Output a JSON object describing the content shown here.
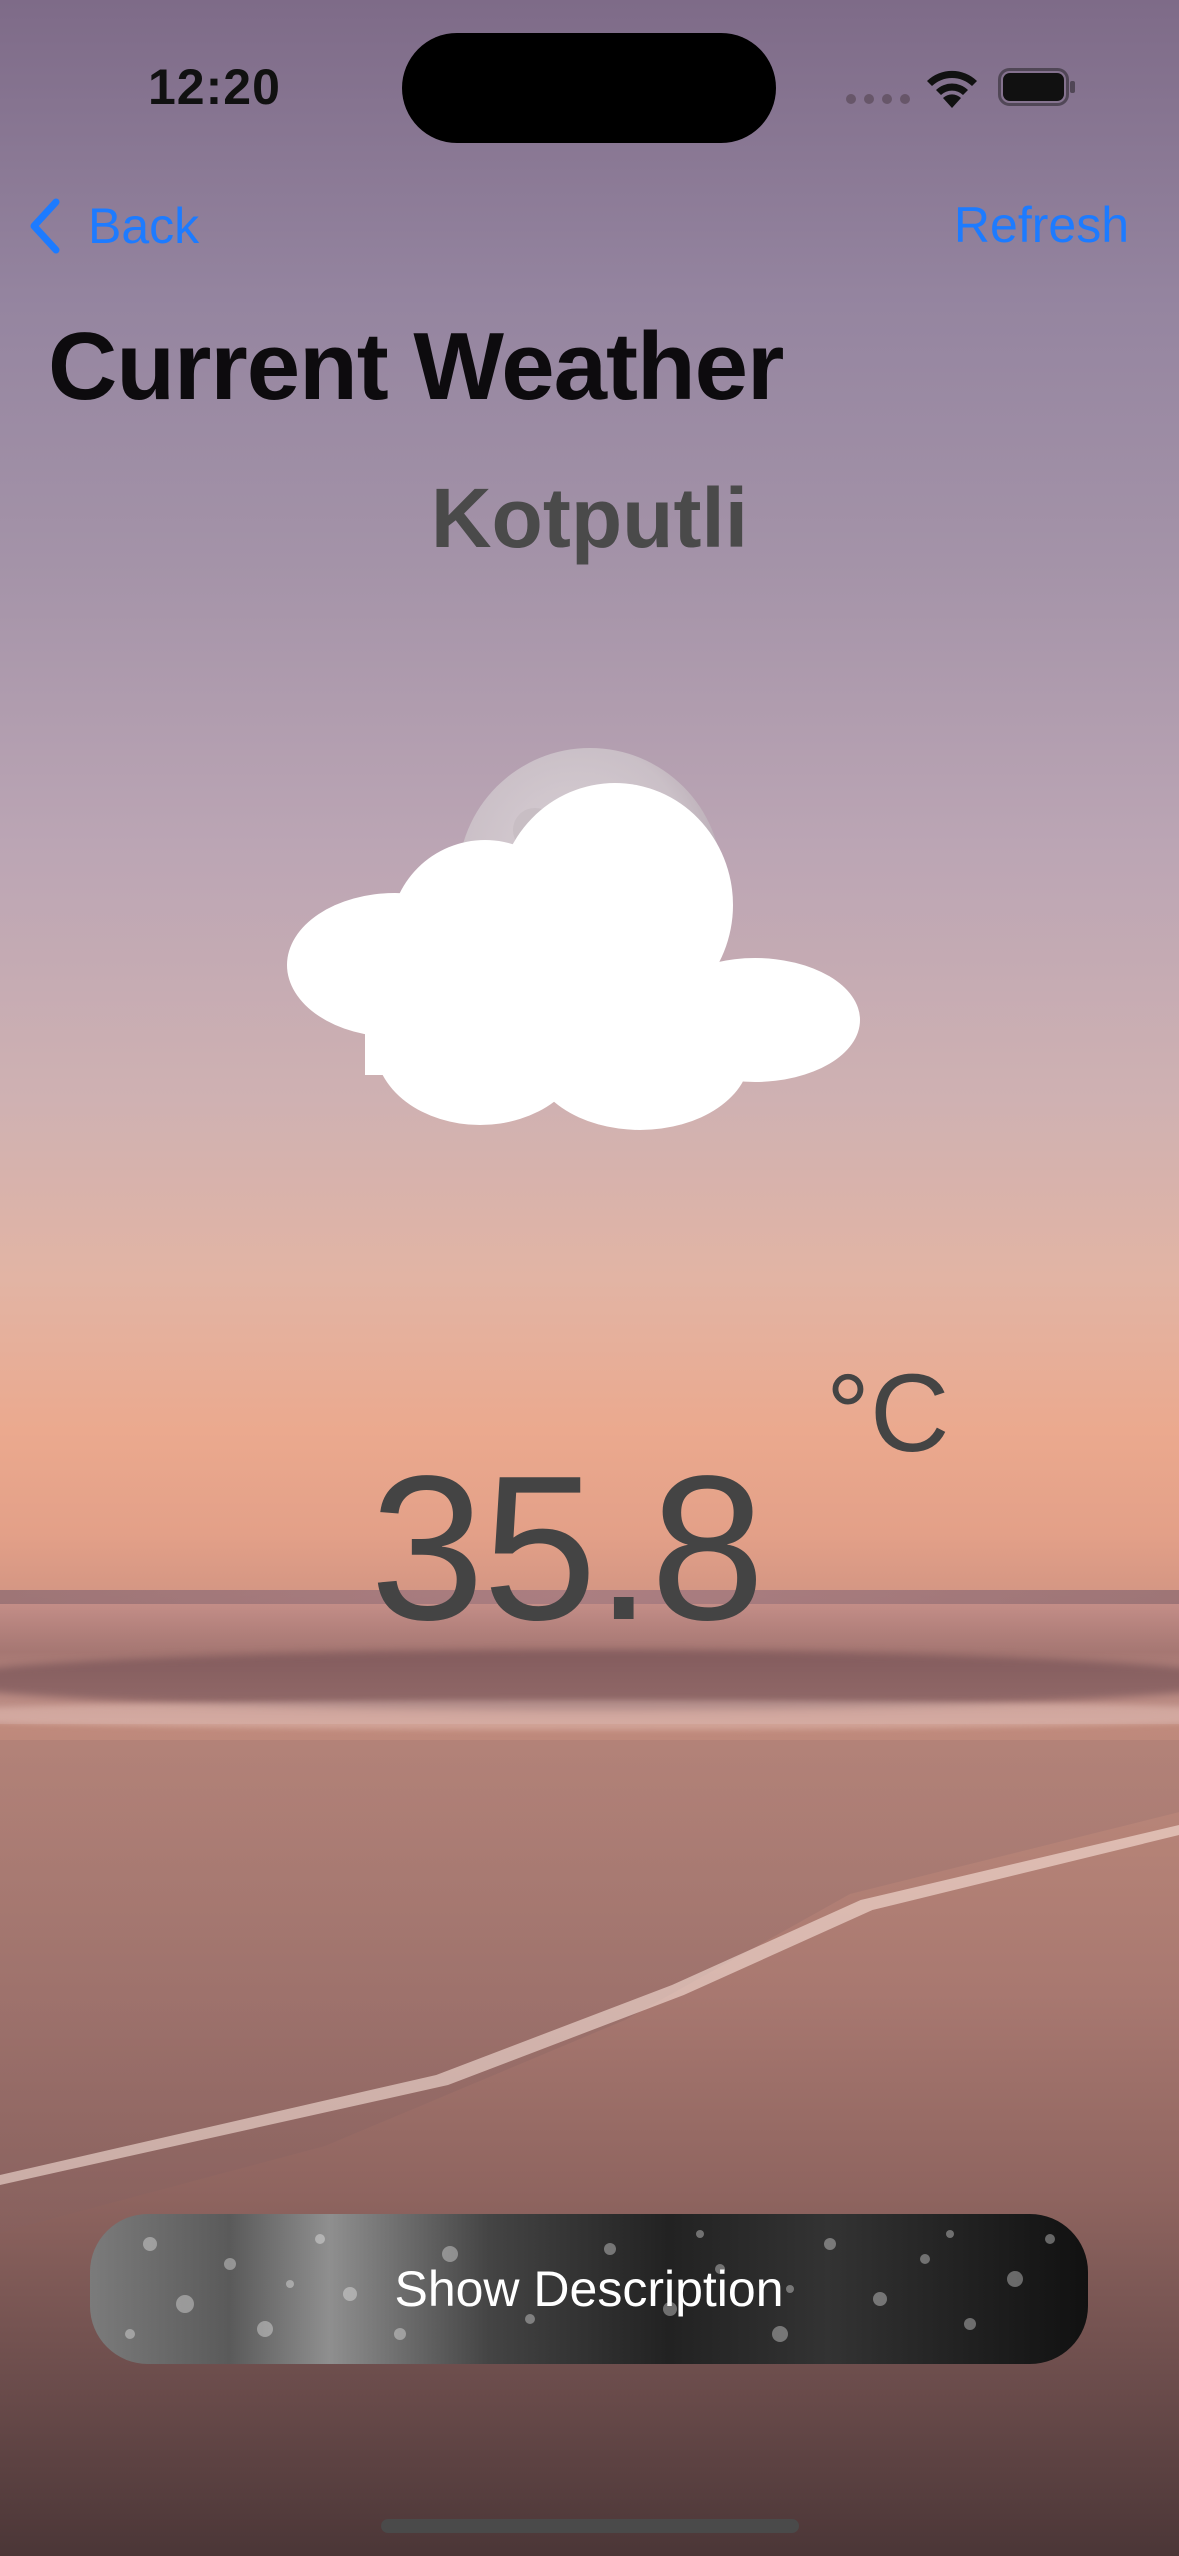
{
  "status_bar": {
    "time": "12:20"
  },
  "nav": {
    "back_label": "Back",
    "refresh_label": "Refresh"
  },
  "page": {
    "title": "Current Weather",
    "city": "Kotputli"
  },
  "weather": {
    "temperature": "35.8",
    "unit": "°C",
    "icon": "partly-cloudy-night-icon"
  },
  "actions": {
    "show_description_label": "Show Description"
  },
  "colors": {
    "accent": "#1d7bff",
    "title": "#0d0b0e",
    "text_secondary": "#444444"
  }
}
